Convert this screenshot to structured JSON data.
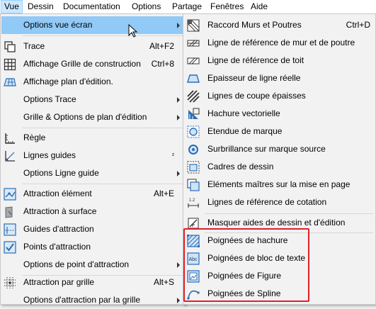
{
  "menubar": {
    "items": [
      "Vue",
      "Dessin",
      "Documentation",
      "Options",
      "Partage",
      "Fenêtres",
      "Aide"
    ],
    "active": "Vue"
  },
  "main_menu": {
    "items": [
      {
        "label": "Options vue écran",
        "shortcut": "",
        "submenu": true,
        "icon": "",
        "highlighted": true
      },
      {
        "label": "Trace",
        "shortcut": "Alt+F2",
        "submenu": false,
        "icon": "trace-icon"
      },
      {
        "label": "Affichage Grille de construction",
        "shortcut": "Ctrl+8",
        "submenu": false,
        "icon": "grid-icon"
      },
      {
        "label": "Affichage plan d'édition.",
        "shortcut": "",
        "submenu": false,
        "icon": "edit-plane-icon"
      },
      {
        "label": "Options Trace",
        "shortcut": "",
        "submenu": true,
        "icon": ""
      },
      {
        "label": "Grille & Options de plan d'édition",
        "shortcut": "",
        "submenu": true,
        "icon": ""
      },
      {
        "label": "Règle",
        "shortcut": "",
        "submenu": false,
        "icon": "ruler-icon"
      },
      {
        "label": "Lignes guides",
        "shortcut": "²",
        "submenu": false,
        "icon": "guide-lines-icon"
      },
      {
        "label": "Options Ligne guide",
        "shortcut": "",
        "submenu": true,
        "icon": ""
      },
      {
        "label": "Attraction élément",
        "shortcut": "Alt+E",
        "submenu": false,
        "icon": "element-snap-icon"
      },
      {
        "label": "Attraction à surface",
        "shortcut": "",
        "submenu": false,
        "icon": "surface-snap-icon"
      },
      {
        "label": "Guides d'attraction",
        "shortcut": "",
        "submenu": false,
        "icon": "snap-guides-icon"
      },
      {
        "label": "Points d'attraction",
        "shortcut": "",
        "submenu": false,
        "icon": "snap-points-icon"
      },
      {
        "label": "Options de point d'attraction",
        "shortcut": "",
        "submenu": true,
        "icon": ""
      },
      {
        "label": "Attraction par grille",
        "shortcut": "Alt+S",
        "submenu": false,
        "icon": "grid-snap-icon"
      },
      {
        "label": "Options d'attraction par la grille",
        "shortcut": "",
        "submenu": true,
        "icon": ""
      }
    ]
  },
  "sub_menu": {
    "items": [
      {
        "label": "Raccord Murs et Poutres",
        "shortcut": "Ctrl+D",
        "icon": "wall-beam-join-icon"
      },
      {
        "label": "Ligne de référence de mur et de poutre",
        "shortcut": "",
        "icon": "wall-reference-line-icon"
      },
      {
        "label": "Ligne de référence de toit",
        "shortcut": "",
        "icon": "roof-reference-line-icon"
      },
      {
        "label": "Epaisseur de ligne réelle",
        "shortcut": "",
        "icon": "true-line-weight-icon"
      },
      {
        "label": "Lignes de coupe épaisses",
        "shortcut": "",
        "icon": "bold-cut-lines-icon"
      },
      {
        "label": "Hachure vectorielle",
        "shortcut": "",
        "icon": "vectorial-hatch-icon"
      },
      {
        "label": "Etendue de marque",
        "shortcut": "",
        "icon": "marker-range-icon"
      },
      {
        "label": "Surbrillance sur marque source",
        "shortcut": "",
        "icon": "source-marker-highlight-icon"
      },
      {
        "label": "Cadres de dessin",
        "shortcut": "",
        "icon": "drawing-frames-icon"
      },
      {
        "label": "Eléments maîtres sur la mise en page",
        "shortcut": "",
        "icon": "master-elements-icon"
      },
      {
        "label": "Lignes de référence de cotation",
        "shortcut": "",
        "icon": "dimension-reference-lines-icon"
      },
      {
        "label": "Masquer aides de dessin et d'édition",
        "shortcut": "",
        "icon": "hide-drawing-aids-icon"
      },
      {
        "label": "Poignées de hachure",
        "shortcut": "",
        "icon": "hatch-handles-icon"
      },
      {
        "label": "Poignées de bloc de texte",
        "shortcut": "",
        "icon": "text-block-handles-icon"
      },
      {
        "label": "Poignées de Figure",
        "shortcut": "",
        "icon": "figure-handles-icon"
      },
      {
        "label": "Poignées de Spline",
        "shortcut": "",
        "icon": "spline-handles-icon"
      }
    ]
  },
  "colors": {
    "highlight": "#91c9f7",
    "menubar_active": "#cce8ff",
    "annotation_box": "#e0202a",
    "icon_blue": "#2a6db5"
  }
}
